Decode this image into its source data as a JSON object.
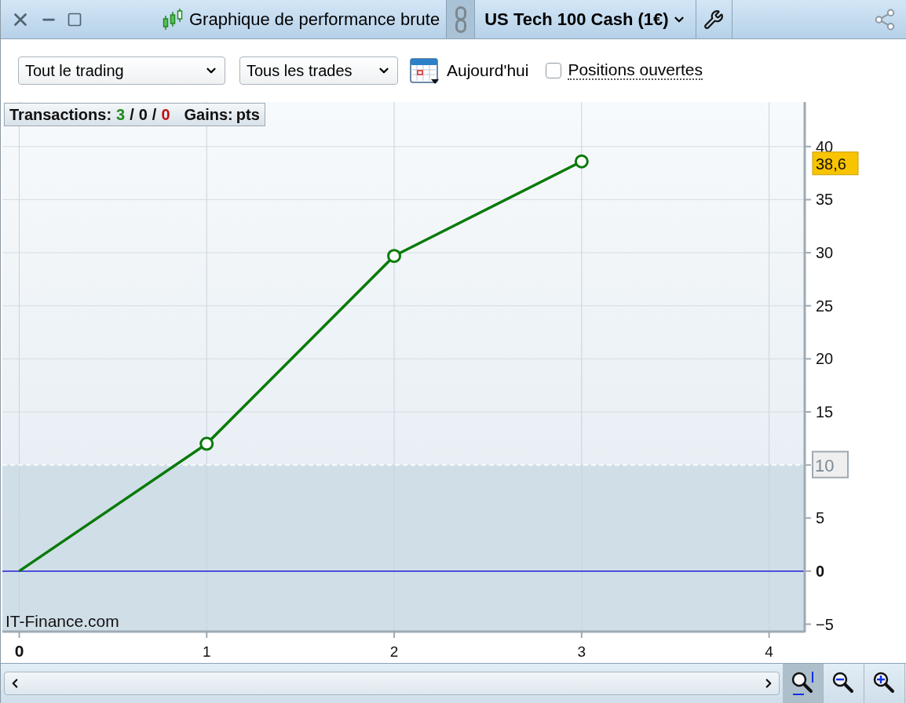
{
  "title_bar": {
    "title": "Graphique de performance brute",
    "instrument": "US Tech 100 Cash (1€)"
  },
  "toolbar": {
    "scope_select": {
      "value": "Tout le trading"
    },
    "trades_select": {
      "value": "Tous les trades"
    },
    "date": {
      "label": "Aujourd'hui"
    },
    "open_positions": {
      "label": "Positions ouvertes",
      "checked": false
    }
  },
  "stats": {
    "transactions_label": "Transactions:",
    "counts": [
      {
        "value": "3",
        "color": "#1e8a1e"
      },
      {
        "value": "0",
        "color": "#111111"
      },
      {
        "value": "0",
        "color": "#c01010"
      }
    ],
    "separator": "/",
    "gains_label": "Gains:",
    "gains_unit": "pts"
  },
  "chart": {
    "last_value_label": "38,6",
    "reference_label": "10",
    "credit": "IT-Finance.com",
    "chart_data": {
      "type": "line",
      "x": [
        0,
        1,
        2,
        3
      ],
      "series": [
        {
          "color": "#0a7a0a",
          "values": [
            0,
            12,
            29.7,
            38.6
          ]
        }
      ],
      "xlim": [
        -0.09,
        4.19
      ],
      "ylim": [
        -5.7,
        44.2
      ],
      "xticks": [
        0,
        1,
        2,
        3,
        4
      ],
      "yticks": [
        -5,
        0,
        5,
        10,
        15,
        20,
        25,
        30,
        35,
        40
      ],
      "grid": true,
      "ref_lines": [
        {
          "axis": "y",
          "value": 10,
          "color": "#ffffff"
        },
        {
          "axis": "y",
          "value": 0,
          "color": "#2020d0"
        }
      ],
      "bands": [
        {
          "axis": "y",
          "from": -5.7,
          "to": 10,
          "color": "#d0dee7"
        }
      ]
    }
  },
  "zoom_tools": [
    {
      "kind": "zoom-fit",
      "selected": true
    },
    {
      "kind": "zoom-out",
      "selected": false
    },
    {
      "kind": "zoom-in",
      "selected": false
    }
  ]
}
